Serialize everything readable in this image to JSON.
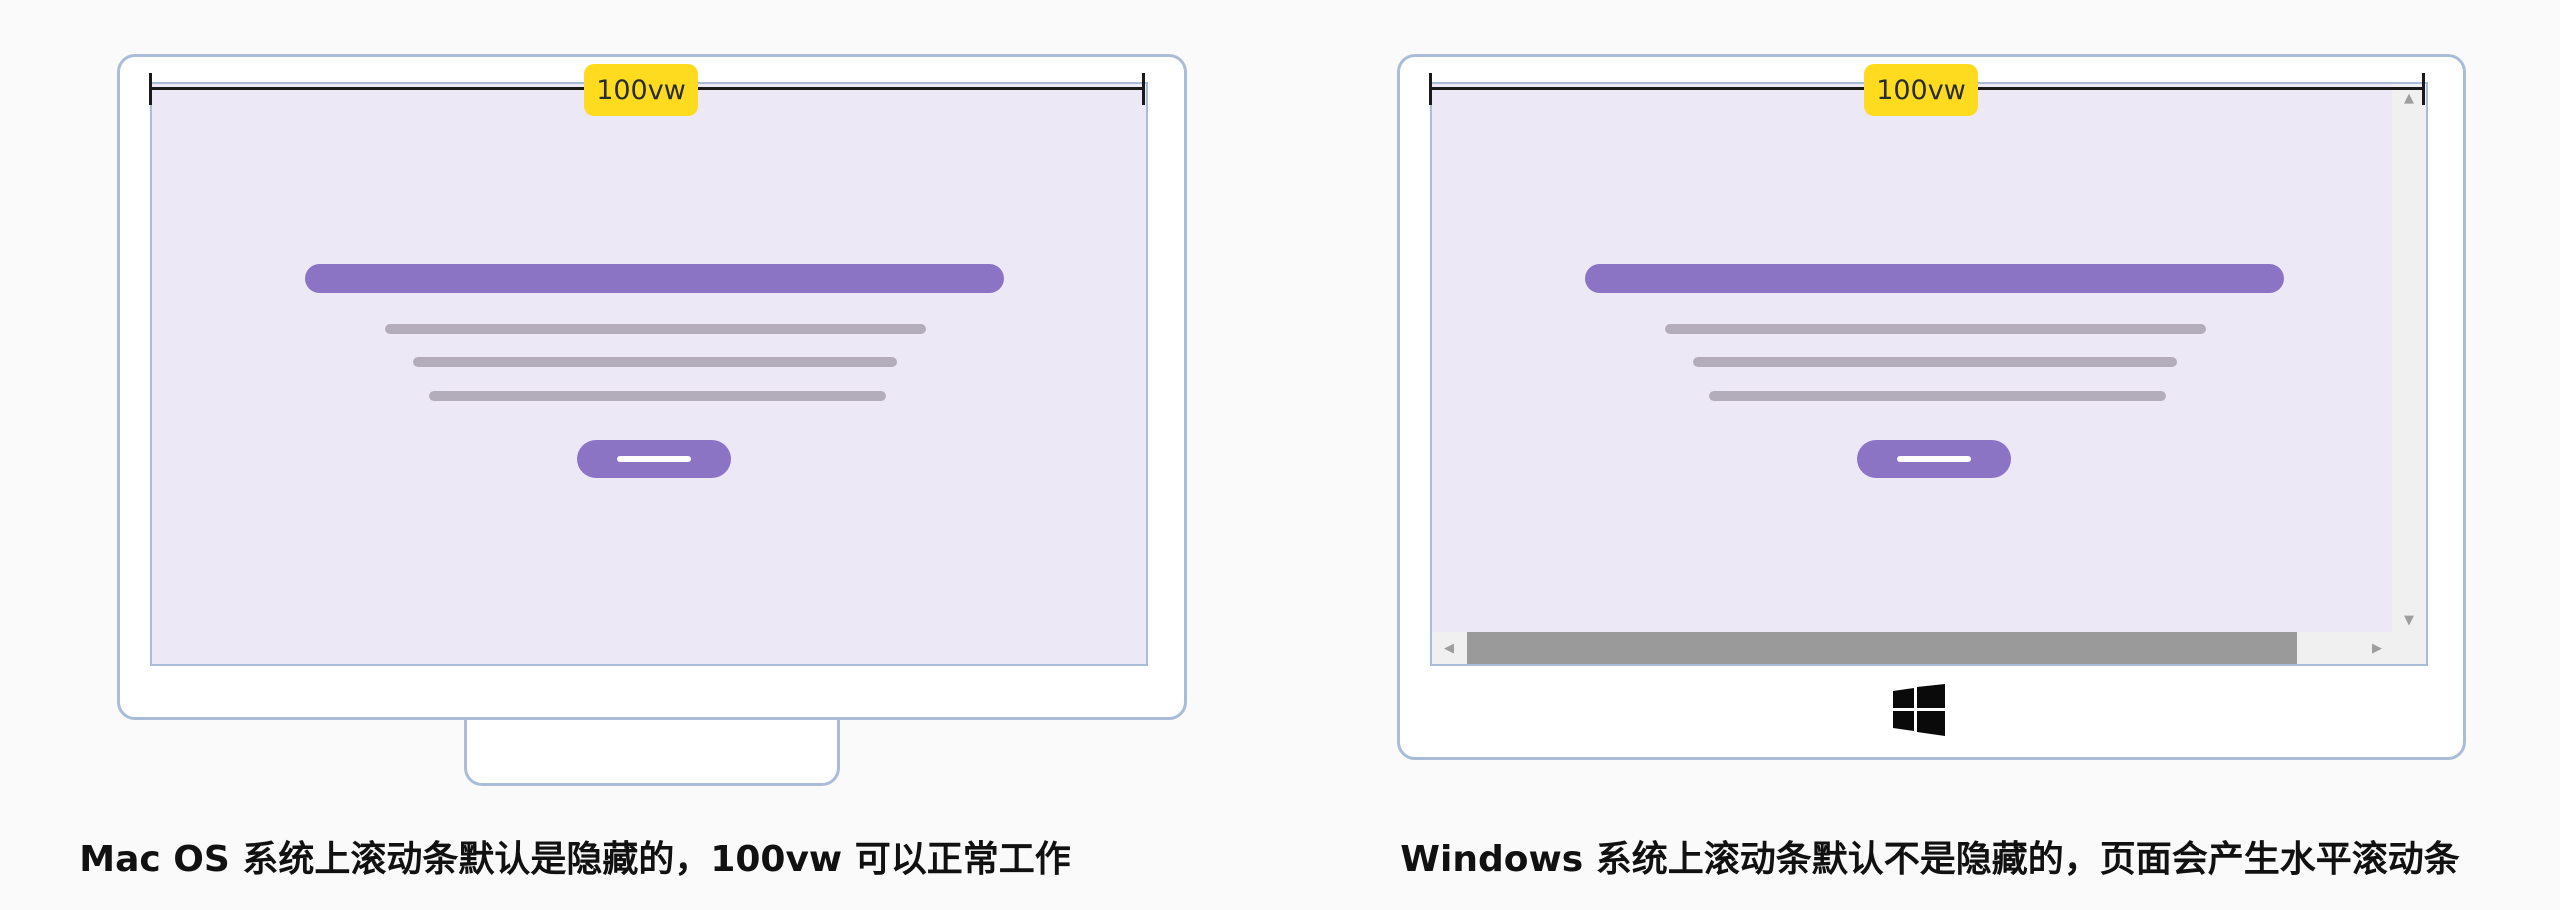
{
  "left": {
    "ruler_label": "100vw",
    "caption": "Mac OS 系统上滚动条默认是隐藏的，100vw 可以正常工作"
  },
  "right": {
    "ruler_label": "100vw",
    "caption": "Windows 系统上滚动条默认不是隐藏的，页面会产生水平滚动条",
    "logo_icon": "windows-logo-icon"
  },
  "colors": {
    "accent": "#8b74c3",
    "badge": "#fedb1f",
    "frame": "#aabcd8",
    "screen": "#ede8f6"
  }
}
